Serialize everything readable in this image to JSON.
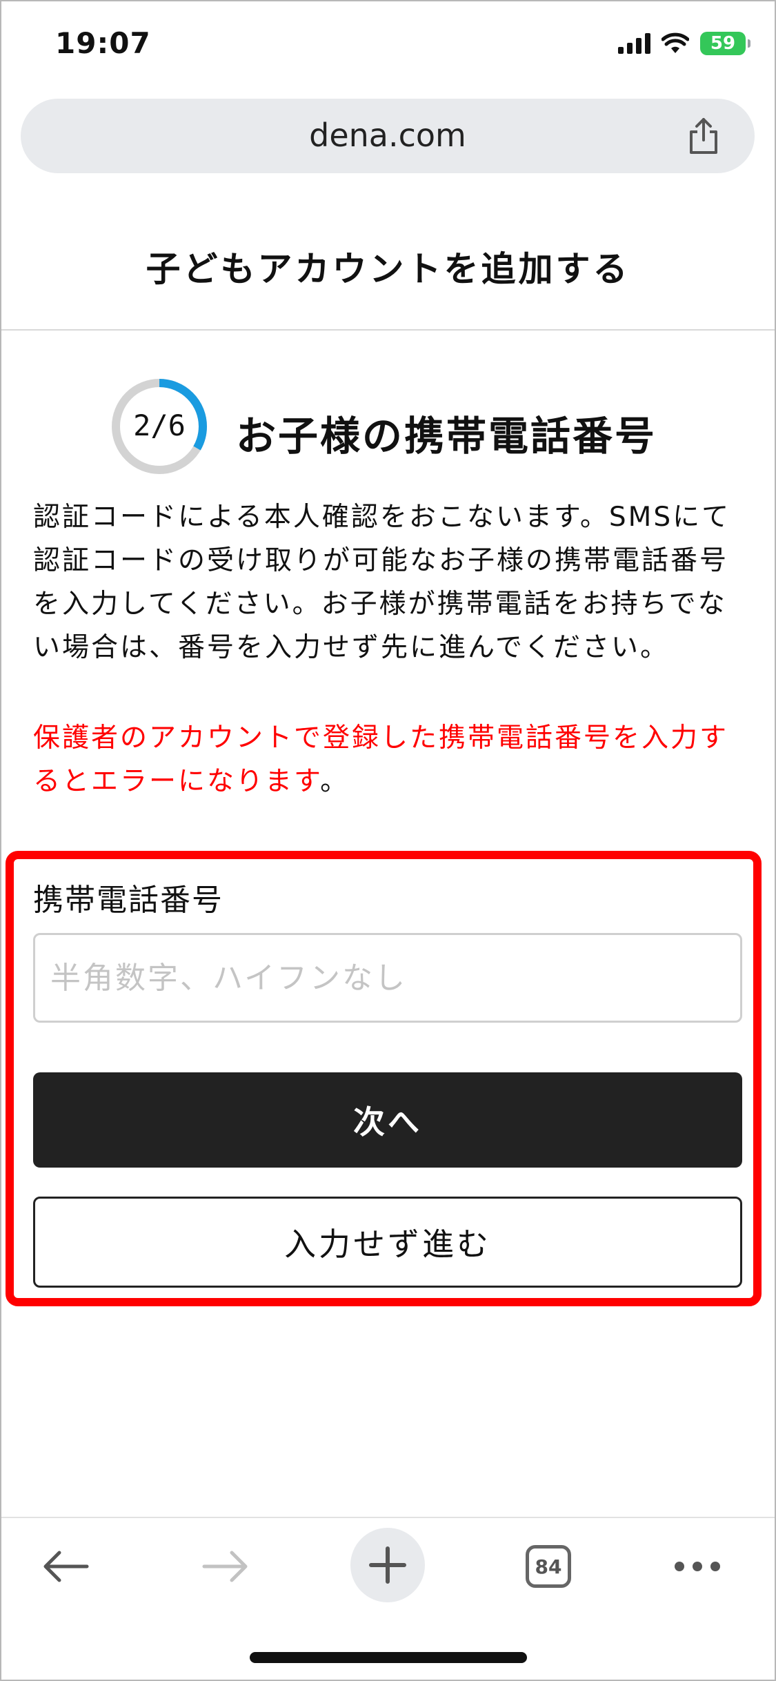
{
  "status_bar": {
    "time": "19:07",
    "battery": "59",
    "icons": [
      "cellular-signal-icon",
      "wifi-icon",
      "battery-icon"
    ]
  },
  "browser": {
    "url": "dena.com",
    "tab_count": "84",
    "toolbar_icons": [
      "back-arrow-icon",
      "forward-arrow-icon",
      "plus-icon",
      "tabs-icon",
      "more-icon"
    ]
  },
  "page": {
    "title": "子どもアカウントを追加する",
    "step": {
      "label": "2/6",
      "current": 2,
      "total": 6,
      "title": "お子様の携帯電話番号"
    },
    "description": "認証コードによる本人確認をおこないます。SMSにて認証コードの受け取りが可能なお子様の携帯電話番号を入力してください。お子様が携帯電話をお持ちでない場合は、番号を入力せず先に進んでください。",
    "warning": "保護者のアカウントで登録した携帯電話番号を入力するとエラーになります",
    "warning_tail": "。"
  },
  "form": {
    "field_label": "携帯電話番号",
    "phone_value": "",
    "phone_placeholder": "半角数字、ハイフンなし",
    "next_label": "次へ",
    "skip_label": "入力せず進む"
  },
  "colors": {
    "highlight": "#ff0000",
    "warning_text": "#ff0000",
    "progress": "#1a9be0",
    "primary_button": "#222222",
    "battery": "#34c759"
  }
}
